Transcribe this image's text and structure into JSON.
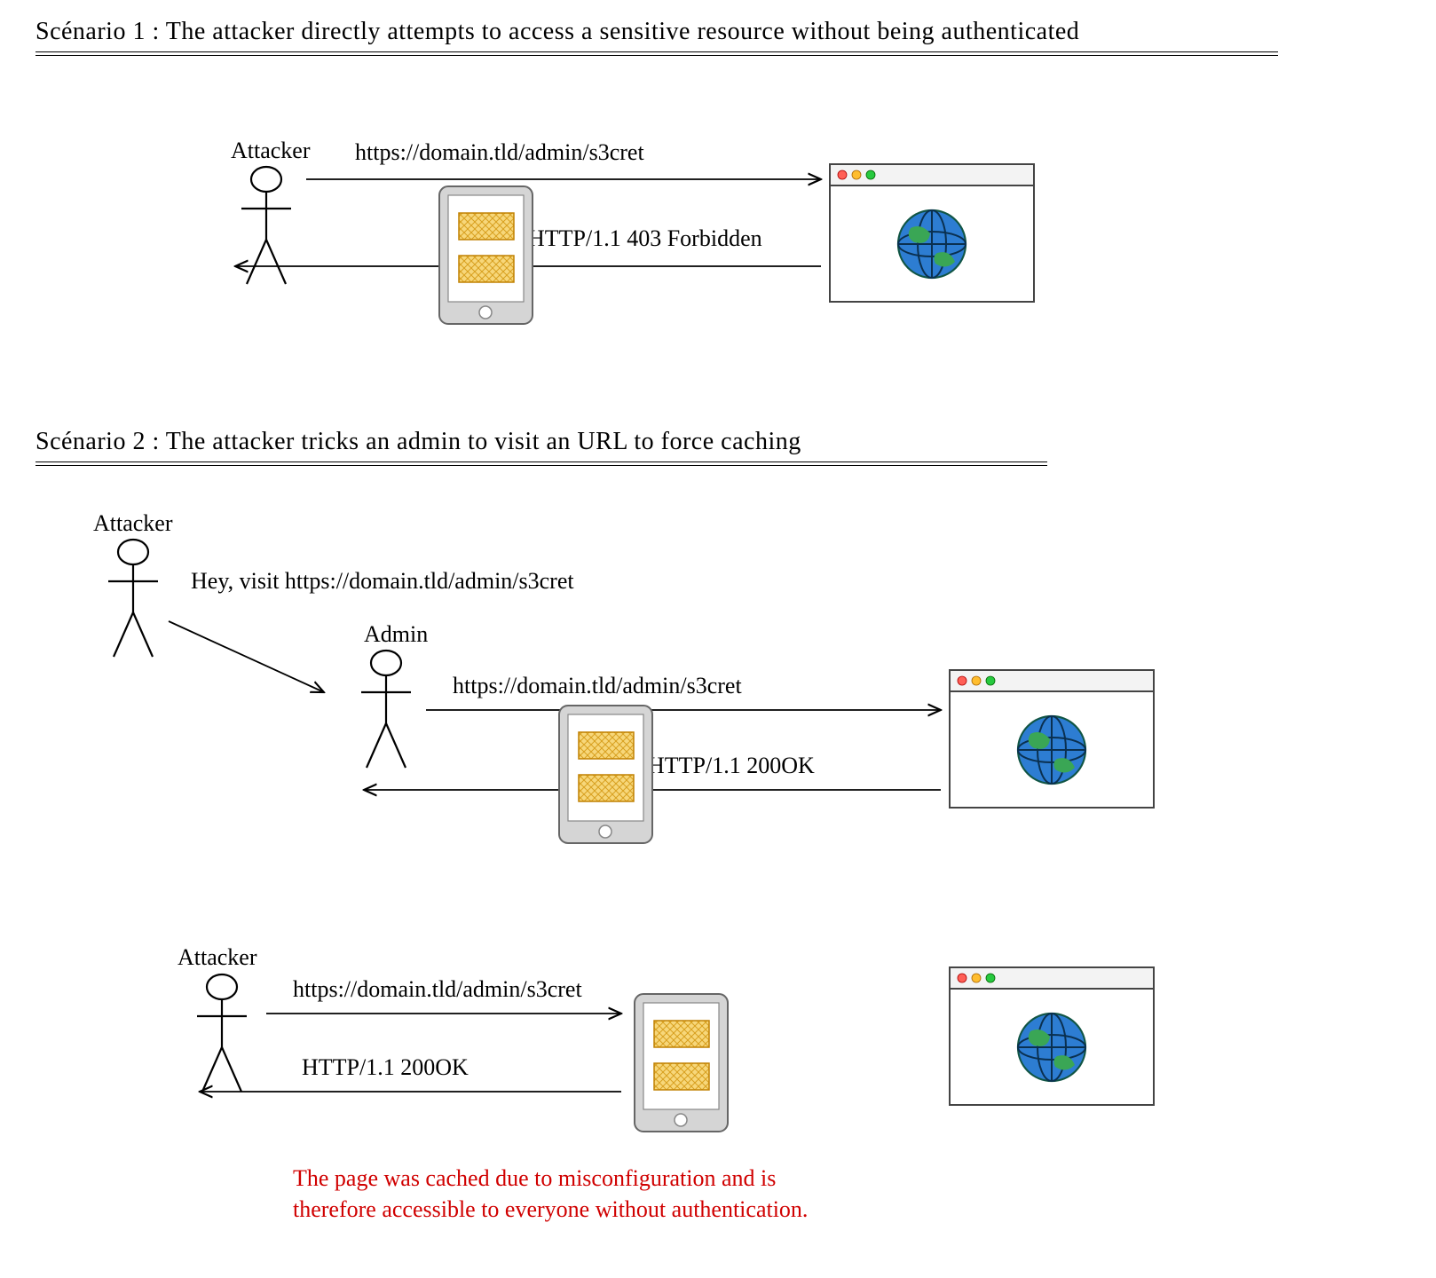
{
  "scenario1": {
    "title": "Scénario 1 : The attacker directly attempts to access a sensitive resource without being authenticated",
    "attacker_label": "Attacker",
    "request_url": "https://domain.tld/admin/s3cret",
    "response": "HTTP/1.1 403 Forbidden"
  },
  "scenario2": {
    "title": "Scénario 2 : The attacker tricks an admin to visit an URL to force caching",
    "attacker_label": "Attacker",
    "trick_message": "Hey, visit https://domain.tld/admin/s3cret",
    "admin_label": "Admin",
    "admin_request_url": "https://domain.tld/admin/s3cret",
    "admin_response": "HTTP/1.1 200OK",
    "attacker2_label": "Attacker",
    "attacker2_request_url": "https://domain.tld/admin/s3cret",
    "attacker2_response": "HTTP/1.1 200OK",
    "warning": "The page was cached due to misconfiguration and is\ntherefore accessible to everyone without authentication."
  }
}
